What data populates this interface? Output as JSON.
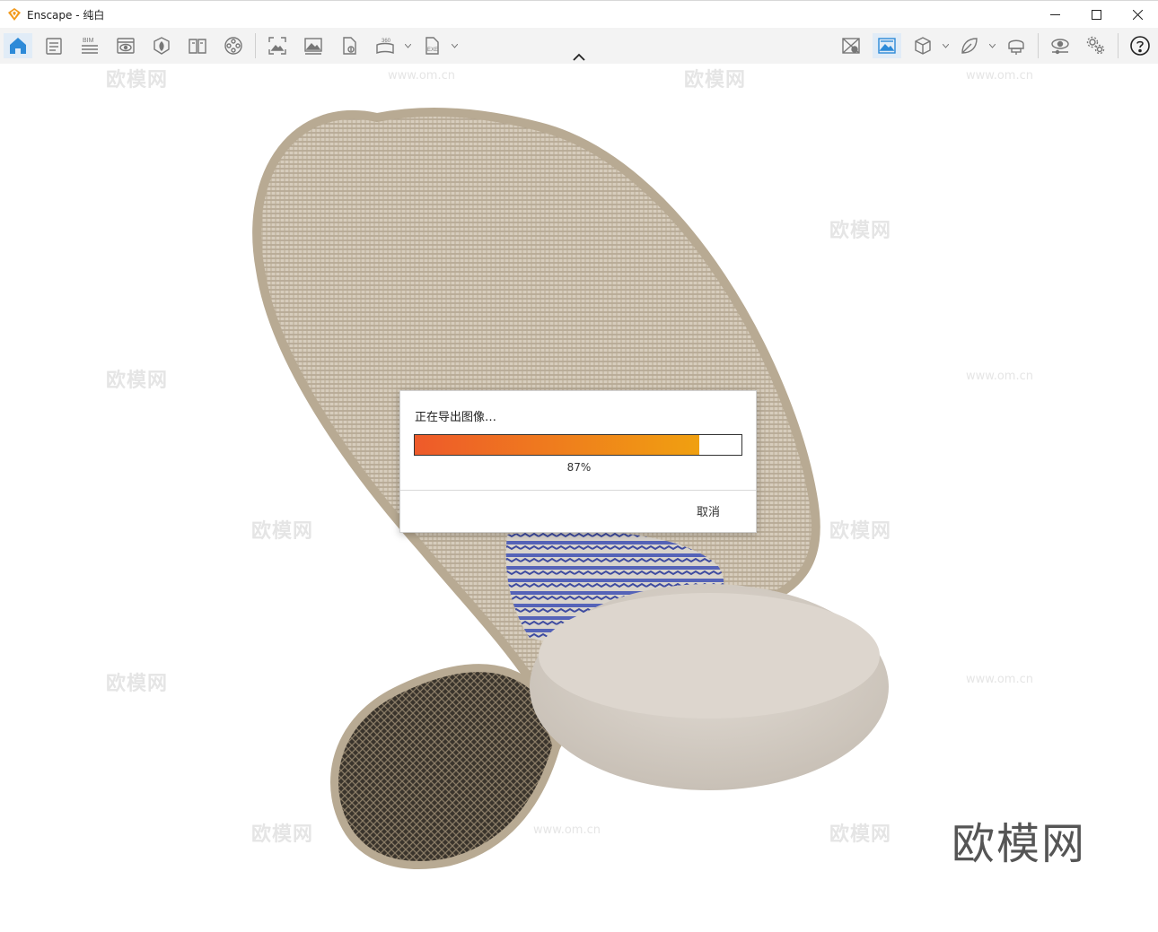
{
  "window": {
    "title": "Enscape - 纯白",
    "logo_icon": "enscape-logo-icon",
    "controls": [
      "minimize-icon",
      "maximize-icon",
      "close-icon"
    ]
  },
  "toolbar": {
    "left_tools": [
      {
        "name": "home",
        "icon": "home-icon",
        "active": true
      },
      {
        "name": "views",
        "icon": "views-list-icon"
      },
      {
        "name": "bim",
        "icon": "bim-icon",
        "label": "BIM"
      },
      {
        "name": "visual-settings",
        "icon": "eye-window-icon"
      },
      {
        "name": "asset-library",
        "icon": "asset-library-icon"
      },
      {
        "name": "material-editor",
        "icon": "book-icon"
      },
      {
        "name": "video-editor",
        "icon": "film-reel-icon"
      },
      {
        "name": "screenshot",
        "icon": "screenshot-icon"
      },
      {
        "name": "batch-render",
        "icon": "image-stack-icon"
      },
      {
        "name": "web-standalone",
        "icon": "file-upload-icon"
      },
      {
        "name": "panorama",
        "icon": "panorama-360-icon",
        "label": "360",
        "dropdown": true
      },
      {
        "name": "exe-export",
        "icon": "exe-file-icon",
        "label": "EXE",
        "dropdown": true
      }
    ],
    "right_tools": [
      {
        "name": "map-off",
        "icon": "map-cross-icon"
      },
      {
        "name": "synced-view",
        "icon": "landscape-view-icon",
        "active": true
      },
      {
        "name": "view-mode",
        "icon": "cube-icon",
        "dropdown": true
      },
      {
        "name": "collaboration",
        "icon": "leaf-icon",
        "dropdown": true
      },
      {
        "name": "vr-headset",
        "icon": "vr-headset-icon"
      },
      {
        "name": "preview",
        "icon": "eye-slider-icon"
      },
      {
        "name": "settings",
        "icon": "gears-icon"
      },
      {
        "name": "help",
        "icon": "help-circle-icon"
      }
    ],
    "collapse_icon": "chevron-up-icon"
  },
  "export_dialog": {
    "status": "正在导出图像…",
    "progress": 0.87,
    "percent_label": "87%",
    "cancel_label": "取消",
    "progress_colors": [
      "#ee5a2a",
      "#f0a010"
    ]
  },
  "watermarks": {
    "site": "www.om.cn",
    "brand": "欧模网",
    "corner_brand": "欧模网"
  }
}
